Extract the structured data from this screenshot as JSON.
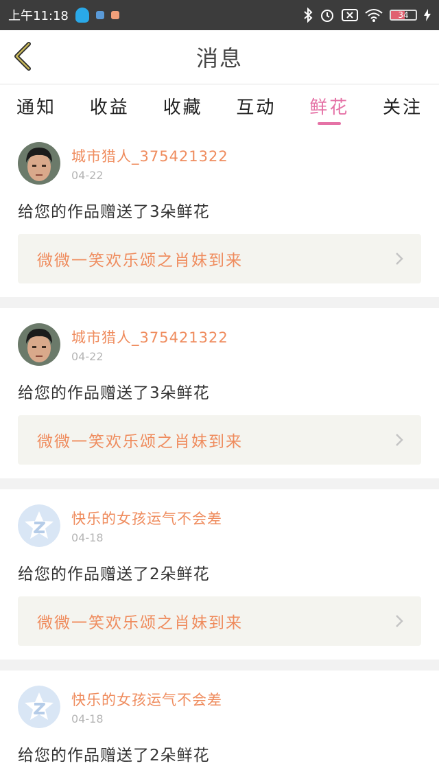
{
  "statusbar": {
    "time": "上午11:18",
    "battery": "34"
  },
  "header": {
    "title": "消息"
  },
  "tabs": [
    {
      "label": "通知"
    },
    {
      "label": "收益"
    },
    {
      "label": "收藏"
    },
    {
      "label": "互动"
    },
    {
      "label": "鲜花"
    },
    {
      "label": "关注"
    }
  ],
  "active_tab": "鲜花",
  "messages": [
    {
      "user": "城市猎人_375421322",
      "date": "04-22",
      "text": "给您的作品赠送了3朵鲜花",
      "work": "微微一笑欢乐颂之肖妹到来",
      "avatar": "photo"
    },
    {
      "user": "城市猎人_375421322",
      "date": "04-22",
      "text": "给您的作品赠送了3朵鲜花",
      "work": "微微一笑欢乐颂之肖妹到来",
      "avatar": "photo"
    },
    {
      "user": "快乐的女孩运气不会差",
      "date": "04-18",
      "text": "给您的作品赠送了2朵鲜花",
      "work": "微微一笑欢乐颂之肖妹到来",
      "avatar": "default"
    },
    {
      "user": "快乐的女孩运气不会差",
      "date": "04-18",
      "text": "给您的作品赠送了2朵鲜花",
      "work": "",
      "avatar": "default"
    }
  ],
  "colors": {
    "accent": "#e572a6",
    "name": "#ef8c5e",
    "card_bg": "#f4f4ef"
  }
}
